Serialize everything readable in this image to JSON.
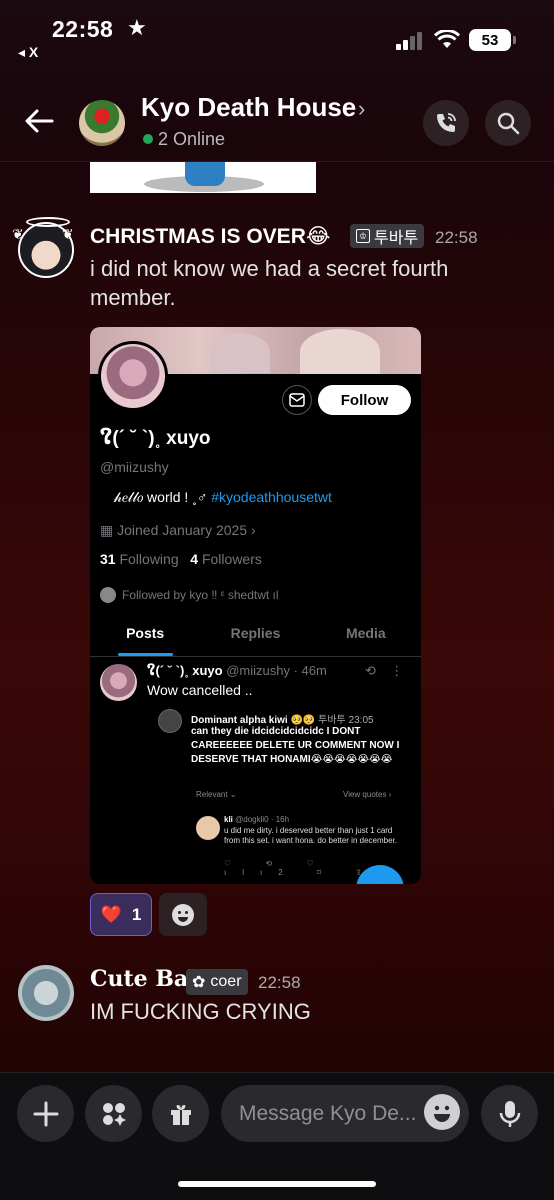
{
  "status": {
    "time": "22:58",
    "star": "★",
    "back_app": "◂ X",
    "battery": "53"
  },
  "header": {
    "title": "Kyo Death House",
    "online": "2 Online"
  },
  "messages": [
    {
      "user": "CHRISTMAS IS OVER😂",
      "tag": "투바투",
      "time": "22:58",
      "text": "i did not know we had a secret fourth member."
    },
    {
      "user": "Cute Baby",
      "tag": "coer",
      "time": "22:58",
      "text": "IM FUCKING CRYING"
    }
  ],
  "screenshot": {
    "follow": "Follow",
    "name": "ໃ(´ ˘ `)˳ xuyo",
    "handle": "@miizushy",
    "bio": "𝒽𝑒𝓁𝓁𝑜   world !   ˳♂",
    "bio_tag": "#kyodeathhousetwt",
    "joined": "Joined January 2025",
    "following_count": "31",
    "following_label": "Following",
    "followers_count": "4",
    "followers_label": "Followers",
    "followed_by": "Followed by kyo ‼ ᵋ shedtwt ıl",
    "tabs": [
      "Posts",
      "Replies",
      "Media"
    ],
    "post": {
      "name": "ໃ(´ ˘ `)˳ xuyo",
      "handle": "@miizushy · 46m",
      "text": "Wow cancelled .."
    },
    "quote": {
      "name": "Dominant alpha kiwi 🥺🥺",
      "tag": "투바투",
      "time": "23:05",
      "text": "can they die idcidcidcidcidc I DONT CAREEEEEE DELETE UR COMMENT NOW I DESERVE THAT HONAMI😭😭😭😭😭😭😭",
      "relevant": "Relevant ⌄",
      "view_quotes": "View quotes ›"
    },
    "reply": {
      "name": "kli",
      "handle": "@dogkli0 · 16h",
      "text": "u did me dirty. i deserved better than just 1 card from this set. i want hona. do better in december.",
      "acts": "♡ ⟲ ♡ ılı2 ⌑ ⇪"
    }
  },
  "reaction": {
    "emoji": "❤️",
    "count": "1"
  },
  "composer": {
    "placeholder": "Message Kyo De..."
  }
}
